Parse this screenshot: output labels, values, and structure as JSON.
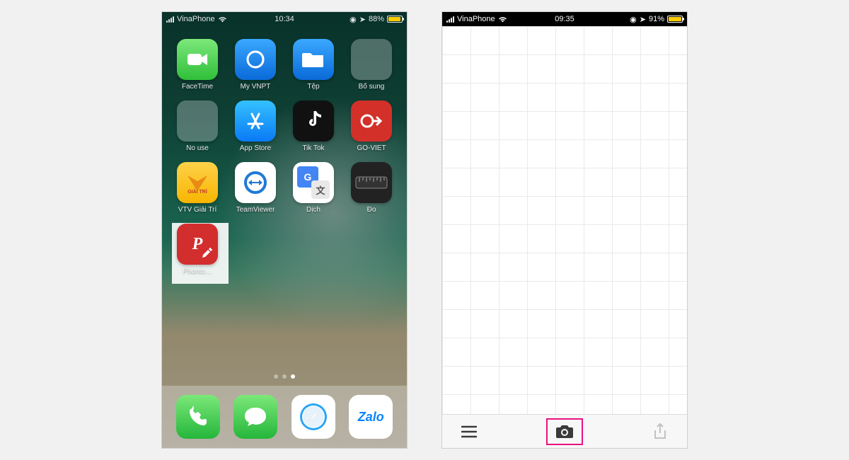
{
  "left": {
    "status": {
      "carrier": "VinaPhone",
      "time": "10:34",
      "battery_pct": "88%",
      "battery_fill": 88
    },
    "apps": [
      {
        "label": "FaceTime",
        "tile": "t-facetime",
        "icon": "camera"
      },
      {
        "label": "My VNPT",
        "tile": "t-vnpt",
        "icon": "vnpt"
      },
      {
        "label": "Tệp",
        "tile": "t-files",
        "icon": "folder"
      },
      {
        "label": "Bổ sung",
        "tile": "folder",
        "icon": "folder-group"
      },
      {
        "label": "No use",
        "tile": "folder",
        "icon": "folder-group"
      },
      {
        "label": "App Store",
        "tile": "t-appstore",
        "icon": "appstore"
      },
      {
        "label": "Tik Tok",
        "tile": "t-tiktok",
        "icon": "tiktok"
      },
      {
        "label": "GO-VIET",
        "tile": "t-goviet",
        "icon": "goviet"
      },
      {
        "label": "VTV Giải Trí",
        "tile": "t-vtv",
        "icon": "vtv"
      },
      {
        "label": "TeamViewer",
        "tile": "t-teamviewer",
        "icon": "teamviewer"
      },
      {
        "label": "Dịch",
        "tile": "t-dich",
        "icon": "translate"
      },
      {
        "label": "Đo",
        "tile": "t-do",
        "icon": "ruler"
      },
      {
        "label": "Phonto…",
        "tile": "t-phonto",
        "icon": "phonto"
      }
    ],
    "dock": [
      {
        "name": "phone",
        "tile": "t-phone",
        "icon": "phone"
      },
      {
        "name": "messages",
        "tile": "t-msg",
        "icon": "message"
      },
      {
        "name": "safari",
        "tile": "t-safari",
        "icon": "safari"
      },
      {
        "name": "zalo",
        "tile": "t-zalo",
        "label": "Zalo"
      }
    ],
    "page_index": 2,
    "page_count": 3
  },
  "right": {
    "status": {
      "carrier": "VinaPhone",
      "time": "09:35",
      "battery_pct": "91%",
      "battery_fill": 91
    },
    "toolbar": {
      "menu": "menu-icon",
      "camera": "camera-icon",
      "share": "share-icon"
    }
  }
}
